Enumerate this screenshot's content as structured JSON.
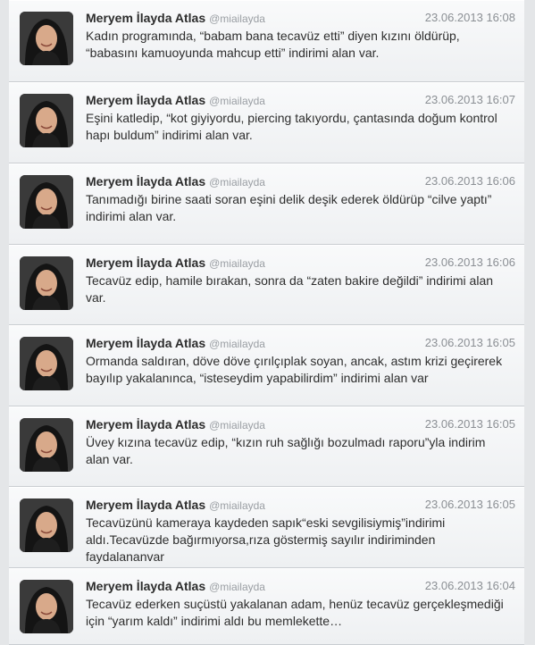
{
  "feed": {
    "tweets": [
      {
        "name": "Meryem İlayda Atlas",
        "handle": "@miailayda",
        "time": "23.06.2013 16:08",
        "text": "Kadın programında, “babam bana tecavüz etti” diyen kızını öldürüp, “babasını kamuoyunda mahcup etti” indirimi alan var."
      },
      {
        "name": "Meryem İlayda Atlas",
        "handle": "@miailayda",
        "time": "23.06.2013 16:07",
        "text": "Eşini katledip, “kot giyiyordu, piercing takıyordu, çantasında doğum kontrol hapı buldum” indirimi alan var."
      },
      {
        "name": "Meryem İlayda Atlas",
        "handle": "@miailayda",
        "time": "23.06.2013 16:06",
        "text": "Tanımadığı birine saati soran eşini delik deşik ederek öldürüp “cilve yaptı” indirimi alan var."
      },
      {
        "name": "Meryem İlayda Atlas",
        "handle": "@miailayda",
        "time": "23.06.2013 16:06",
        "text": "Tecavüz edip, hamile bırakan, sonra da “zaten bakire değildi” indirimi alan var."
      },
      {
        "name": "Meryem İlayda Atlas",
        "handle": "@miailayda",
        "time": "23.06.2013 16:05",
        "text": "Ormanda saldıran, döve döve çırılçıplak soyan, ancak, astım krizi geçirerek bayılıp yakalanınca, “isteseydim yapabilirdim” indirimi alan var"
      },
      {
        "name": "Meryem İlayda Atlas",
        "handle": "@miailayda",
        "time": "23.06.2013 16:05",
        "text": "Üvey kızına tecavüz edip, “kızın ruh sağlığı bozulmadı raporu”yla indirim alan var."
      },
      {
        "name": "Meryem İlayda Atlas",
        "handle": "@miailayda",
        "time": "23.06.2013 16:05",
        "text": "Tecavüzünü kameraya kaydeden sapık“eski sevgilisiymiş”indirimi aldı.Tecavüzde bağırmıyorsa,rıza göstermiş sayılır indiriminden faydalananvar"
      },
      {
        "name": "Meryem İlayda Atlas",
        "handle": "@miailayda",
        "time": "23.06.2013 16:04",
        "text": "Tecavüz ederken suçüstü yakalanan adam, henüz tecavüz gerçekleşmediği için “yarım kaldı” indirimi aldı bu memlekette…"
      }
    ]
  },
  "colors": {
    "background": "#e4e6e8",
    "card": "#f4f5f7",
    "name": "#2c2c2c",
    "handle": "#9a9ea3",
    "timestamp": "#8b8f94"
  },
  "icons": {
    "avatar": "profile-photo"
  }
}
